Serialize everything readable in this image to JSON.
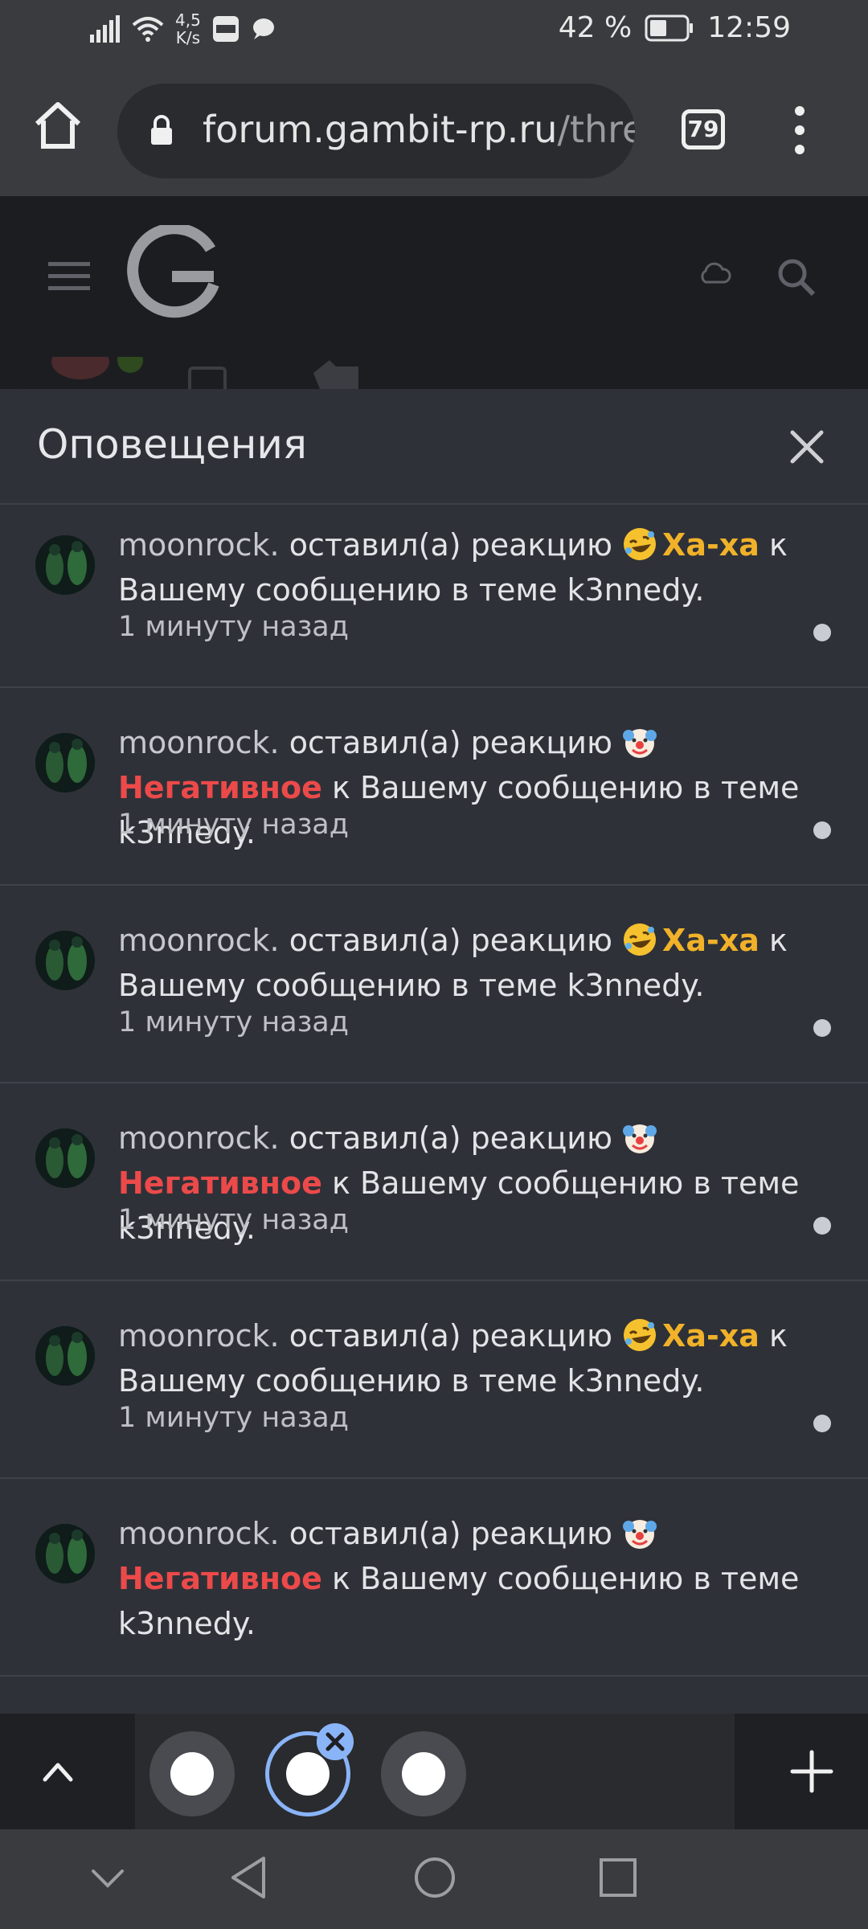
{
  "status_bar": {
    "speed_value": "4,5",
    "speed_unit": "K/s",
    "battery": "42 %",
    "time": "12:59"
  },
  "browser": {
    "url_domain": "forum.gambit-rp.ru",
    "url_path": "/thre",
    "tab_count": "79"
  },
  "panel": {
    "title": "Оповещения"
  },
  "notifications": [
    {
      "user": "",
      "pre": "",
      "reaction": "",
      "type": "",
      "post": "Вашему сообщению в теме k3nnedy.",
      "time": "1 минуту назад"
    },
    {
      "user": "moonrock.",
      "pre": " оставил(а) реакцию ",
      "reaction": "Ха-ха",
      "type": "haha",
      "post": " к Вашему сообщению в теме k3nnedy.",
      "time": "1 минуту назад"
    },
    {
      "user": "moonrock.",
      "pre": " оставил(а) реакцию ",
      "reaction": "Негативное",
      "type": "neg",
      "post": " к Вашему сообщению в теме k3nnedy.",
      "time": "1 минуту назад"
    },
    {
      "user": "moonrock.",
      "pre": " оставил(а) реакцию ",
      "reaction": "Ха-ха",
      "type": "haha",
      "post": " к Вашему сообщению в теме k3nnedy.",
      "time": "1 минуту назад"
    },
    {
      "user": "moonrock.",
      "pre": " оставил(а) реакцию ",
      "reaction": "Негативное",
      "type": "neg",
      "post": " к Вашему сообщению в теме k3nnedy.",
      "time": "1 минуту назад"
    },
    {
      "user": "moonrock.",
      "pre": " оставил(а) реакцию ",
      "reaction": "Ха-ха",
      "type": "haha",
      "post": " к Вашему сообщению в теме k3nnedy.",
      "time": "1 минуту назад"
    },
    {
      "user": "moonrock.",
      "pre": " оставил(а) реакцию ",
      "reaction": "Негативное",
      "type": "neg",
      "post": " к Вашему сообщению в теме k3nnedy.",
      "time": ""
    }
  ],
  "colors": {
    "haha": "#f1b229",
    "negative": "#ec4a4a",
    "accent": "#8ab4f8"
  }
}
